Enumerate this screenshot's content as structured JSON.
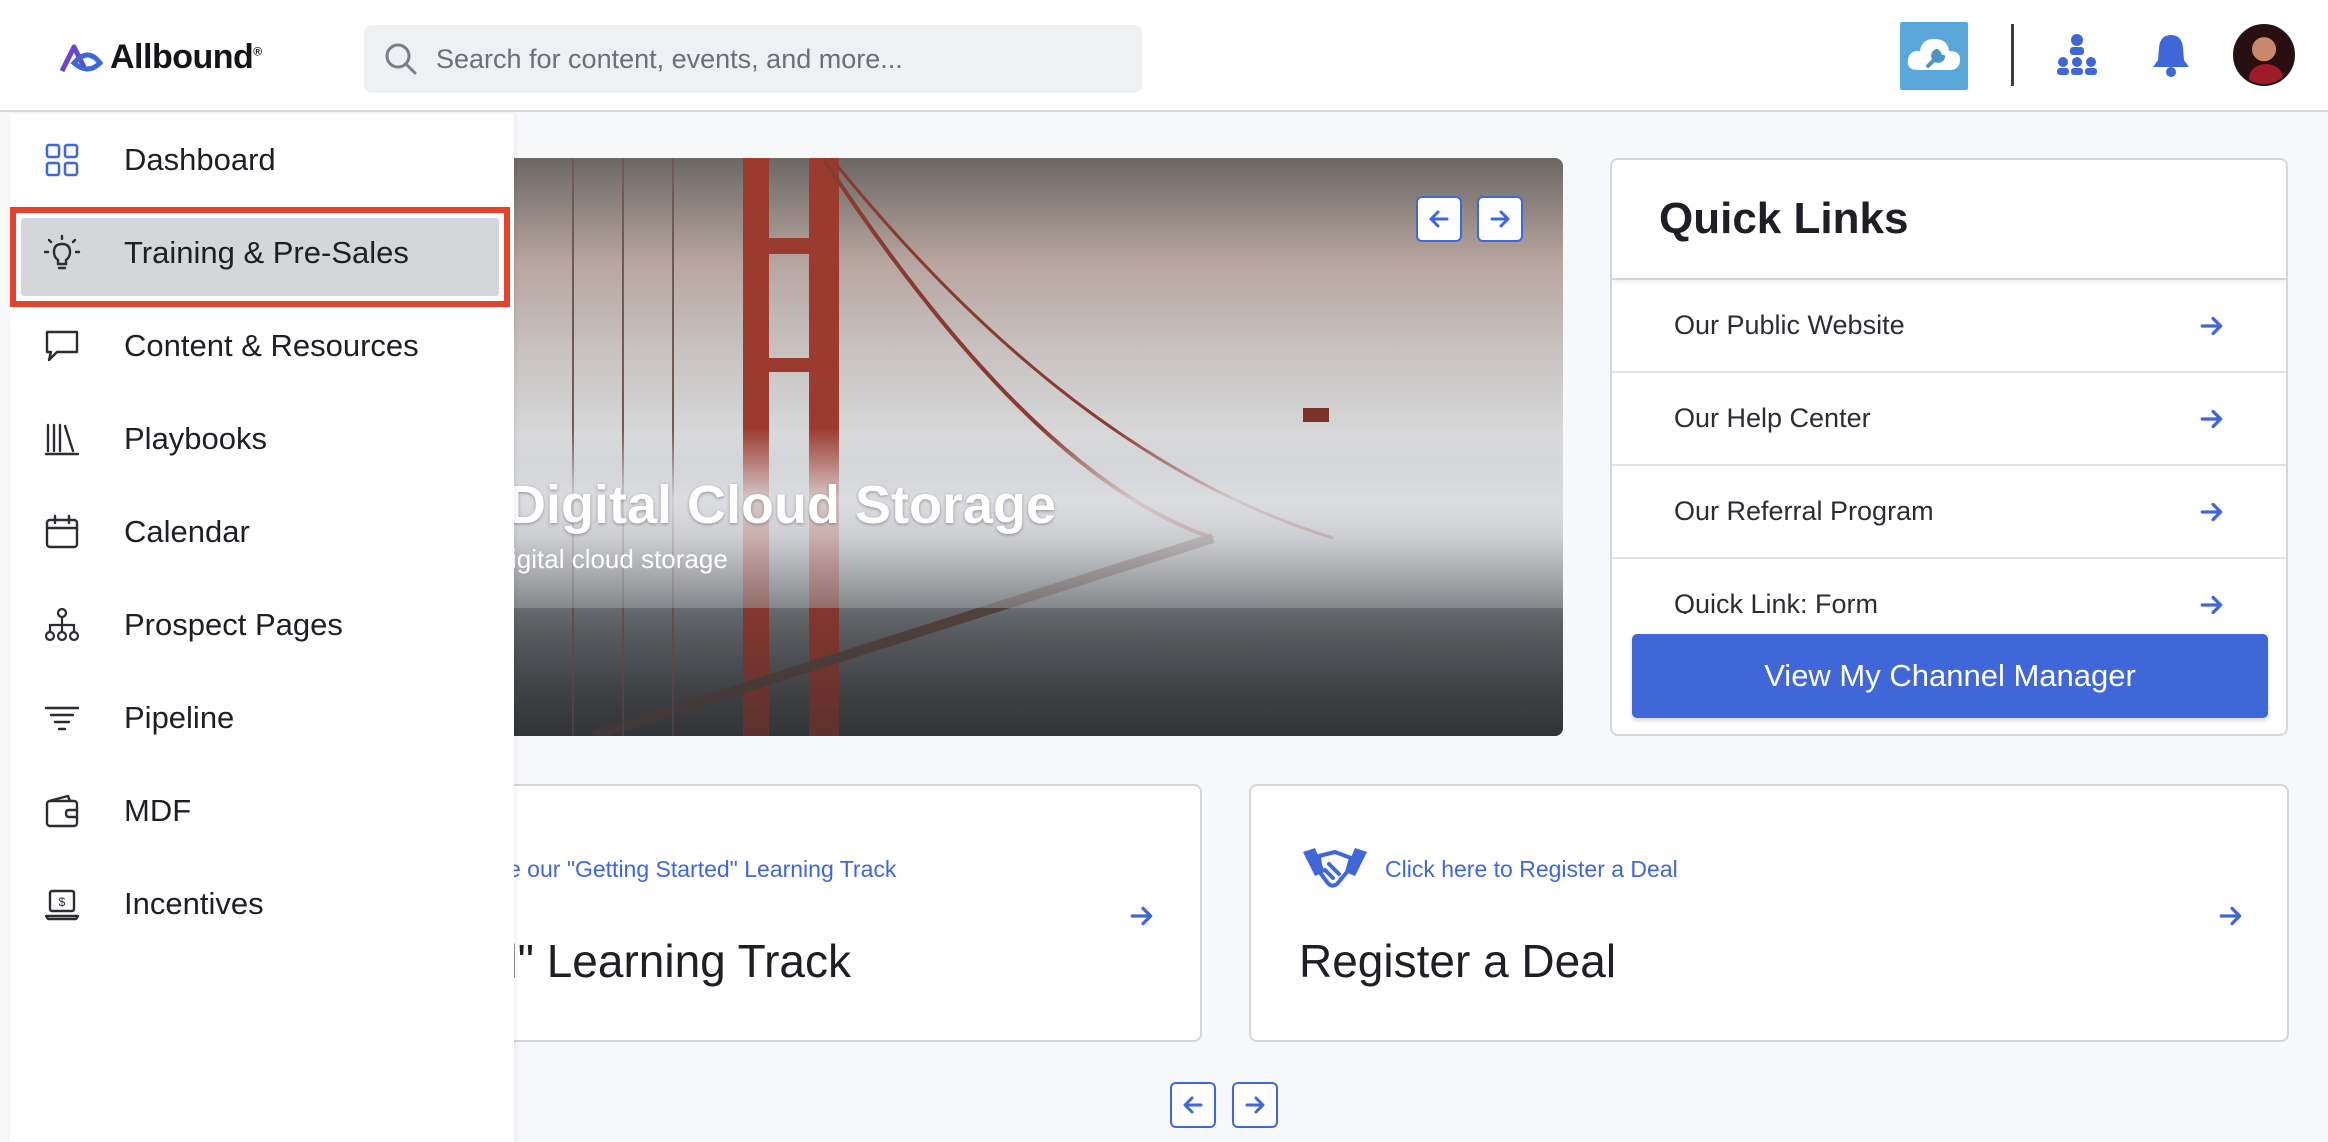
{
  "header": {
    "logo_text": "Allbound",
    "logo_reg": "®",
    "search_placeholder": "Search for content, events, and more...",
    "icons": [
      "cloud-wrench-icon",
      "org-chart-icon",
      "bell-icon",
      "avatar"
    ]
  },
  "sidebar": {
    "items": [
      {
        "label": "Dashboard",
        "icon": "grid-icon"
      },
      {
        "label": "Training & Pre-Sales",
        "icon": "lightbulb-icon",
        "active": true
      },
      {
        "label": "Content & Resources",
        "icon": "chat-icon"
      },
      {
        "label": "Playbooks",
        "icon": "books-icon"
      },
      {
        "label": "Calendar",
        "icon": "calendar-icon"
      },
      {
        "label": "Prospect Pages",
        "icon": "sitemap-icon"
      },
      {
        "label": "Pipeline",
        "icon": "filter-icon"
      },
      {
        "label": "MDF",
        "icon": "wallet-icon"
      },
      {
        "label": "Incentives",
        "icon": "laptop-dollar-icon"
      }
    ]
  },
  "hero": {
    "title": "Digital Cloud Storage",
    "subtitle": "igital cloud storage"
  },
  "quick_links": {
    "title": "Quick Links",
    "links": [
      "Our Public Website",
      "Our Help Center",
      "Our Referral Program",
      "Quick Link: Form"
    ],
    "button_label": "View My Channel Manager"
  },
  "cards": [
    {
      "small": "e our \"Getting Started\" Learning Track",
      "big": "d\" Learning Track"
    },
    {
      "small": "Click here to Register a Deal",
      "big": "Register a Deal"
    }
  ],
  "colors": {
    "accent": "#3f67d8",
    "highlight": "#e8412d",
    "text": "#1d1f24"
  }
}
